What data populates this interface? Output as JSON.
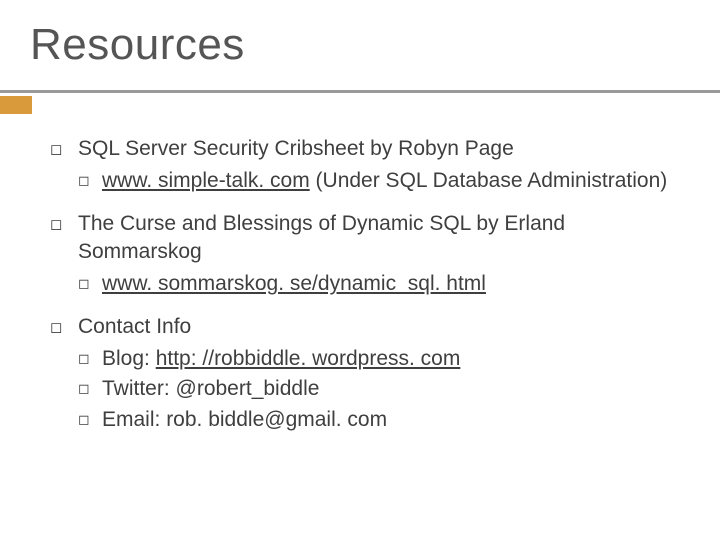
{
  "title": "Resources",
  "accent_color": "#d89a3a",
  "items": [
    {
      "text": "SQL Server Security Cribsheet by Robyn Page",
      "sub": [
        {
          "link": "www. simple-talk. com",
          "text_after": " (Under SQL Database Administration)"
        }
      ]
    },
    {
      "text": "The Curse and Blessings of Dynamic SQL by Erland Sommarskog",
      "sub": [
        {
          "link": "www. sommarskog. se/dynamic_sql. html",
          "text_after": ""
        }
      ]
    },
    {
      "text": "Contact Info",
      "sub": [
        {
          "prefix": "Blog: ",
          "link": "http: //robbiddle. wordpress. com",
          "text_after": ""
        },
        {
          "prefix": "Twitter: ",
          "plain": "@robert_biddle"
        },
        {
          "prefix": "Email: ",
          "plain": "rob. biddle@gmail. com"
        }
      ]
    }
  ],
  "bullets": {
    "l1": "◻",
    "l2": "◻"
  }
}
